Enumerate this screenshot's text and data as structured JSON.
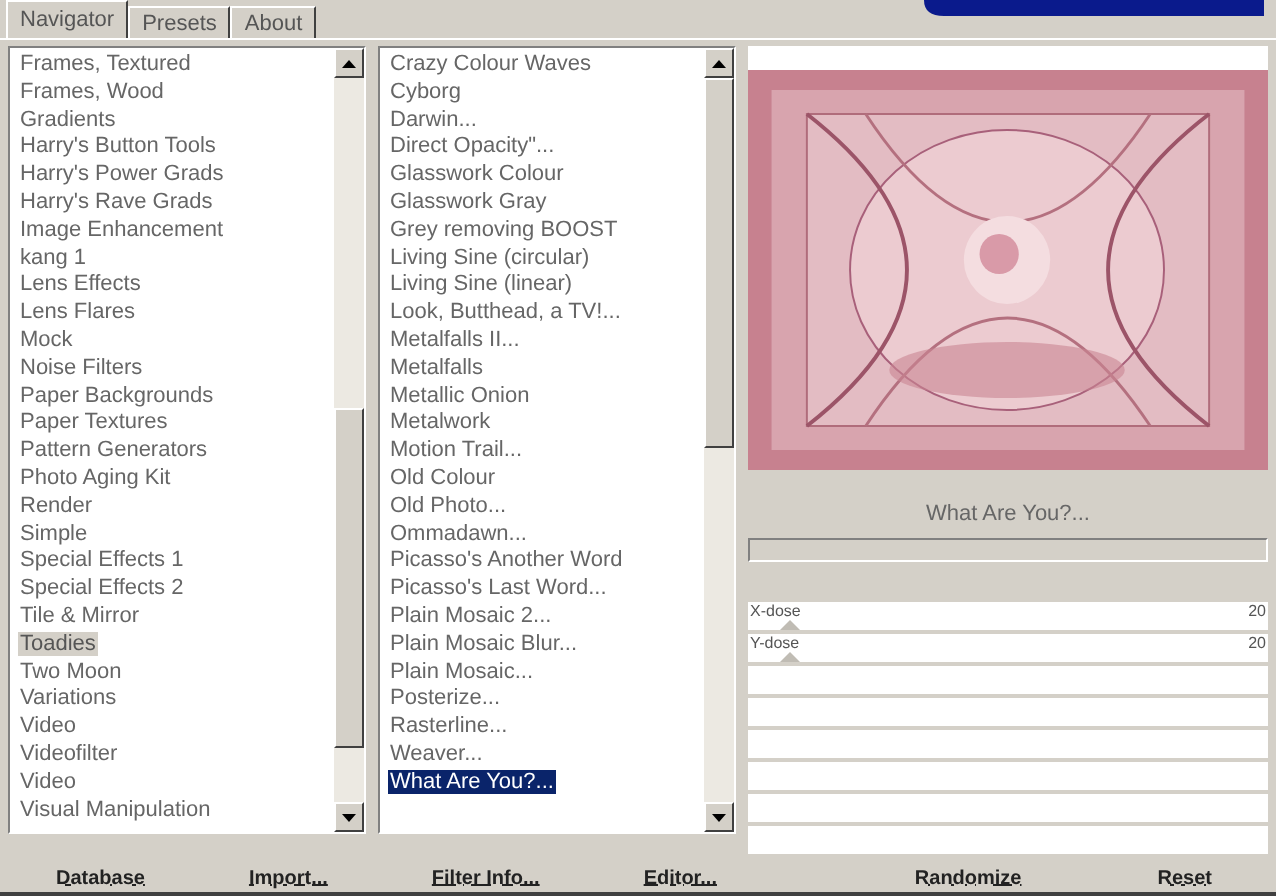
{
  "tabs": [
    {
      "label": "Navigator",
      "selected": true
    },
    {
      "label": "Presets",
      "selected": false
    },
    {
      "label": "About",
      "selected": false
    }
  ],
  "categories": [
    {
      "label": "Frames, Textured",
      "selected": false
    },
    {
      "label": "Frames, Wood",
      "selected": false
    },
    {
      "label": "Gradients",
      "selected": false
    },
    {
      "label": "Harry's Button Tools",
      "selected": false
    },
    {
      "label": "Harry's Power Grads",
      "selected": false
    },
    {
      "label": "Harry's Rave Grads",
      "selected": false
    },
    {
      "label": "Image Enhancement",
      "selected": false
    },
    {
      "label": "kang 1",
      "selected": false
    },
    {
      "label": "Lens Effects",
      "selected": false
    },
    {
      "label": "Lens Flares",
      "selected": false
    },
    {
      "label": "Mock",
      "selected": false
    },
    {
      "label": "Noise Filters",
      "selected": false
    },
    {
      "label": "Paper Backgrounds",
      "selected": false
    },
    {
      "label": "Paper Textures",
      "selected": false
    },
    {
      "label": "Pattern Generators",
      "selected": false
    },
    {
      "label": "Photo Aging Kit",
      "selected": false
    },
    {
      "label": "Render",
      "selected": false
    },
    {
      "label": "Simple",
      "selected": false
    },
    {
      "label": "Special Effects 1",
      "selected": false
    },
    {
      "label": "Special Effects 2",
      "selected": false
    },
    {
      "label": "Tile & Mirror",
      "selected": false
    },
    {
      "label": "Toadies",
      "selected": true
    },
    {
      "label": "Two Moon",
      "selected": false
    },
    {
      "label": "Variations",
      "selected": false
    },
    {
      "label": "Video",
      "selected": false
    },
    {
      "label": "Videofilter",
      "selected": false
    },
    {
      "label": "Video",
      "selected": false
    },
    {
      "label": "Visual Manipulation",
      "selected": false
    }
  ],
  "filters": [
    {
      "label": "Crazy Colour Waves",
      "selected": false
    },
    {
      "label": "Cyborg",
      "selected": false
    },
    {
      "label": "Darwin...",
      "selected": false
    },
    {
      "label": "Direct Opacity\"...",
      "selected": false
    },
    {
      "label": "Glasswork Colour",
      "selected": false
    },
    {
      "label": "Glasswork Gray",
      "selected": false
    },
    {
      "label": "Grey removing BOOST",
      "selected": false
    },
    {
      "label": "Living Sine (circular)",
      "selected": false
    },
    {
      "label": "Living Sine (linear)",
      "selected": false
    },
    {
      "label": "Look, Butthead, a TV!...",
      "selected": false
    },
    {
      "label": "Metalfalls II...",
      "selected": false
    },
    {
      "label": "Metalfalls",
      "selected": false
    },
    {
      "label": "Metallic Onion",
      "selected": false
    },
    {
      "label": "Metalwork",
      "selected": false
    },
    {
      "label": "Motion Trail...",
      "selected": false
    },
    {
      "label": "Old Colour",
      "selected": false
    },
    {
      "label": "Old Photo...",
      "selected": false
    },
    {
      "label": "Ommadawn...",
      "selected": false
    },
    {
      "label": "Picasso's Another Word",
      "selected": false
    },
    {
      "label": "Picasso's Last Word...",
      "selected": false
    },
    {
      "label": "Plain Mosaic 2...",
      "selected": false
    },
    {
      "label": "Plain Mosaic Blur...",
      "selected": false
    },
    {
      "label": "Plain Mosaic...",
      "selected": false
    },
    {
      "label": "Posterize...",
      "selected": false
    },
    {
      "label": "Rasterline...",
      "selected": false
    },
    {
      "label": "Weaver...",
      "selected": false
    },
    {
      "label": "What Are You?...",
      "selected": true
    }
  ],
  "filter_name": "What Are You?...",
  "sliders": [
    {
      "label": "X-dose",
      "value": "20",
      "level": 0.08
    },
    {
      "label": "Y-dose",
      "value": "20",
      "level": 0.08
    }
  ],
  "buttons_left": [
    "Database",
    "Import...",
    "Filter Info...",
    "Editor..."
  ],
  "buttons_right": [
    "Randomize",
    "Reset"
  ]
}
